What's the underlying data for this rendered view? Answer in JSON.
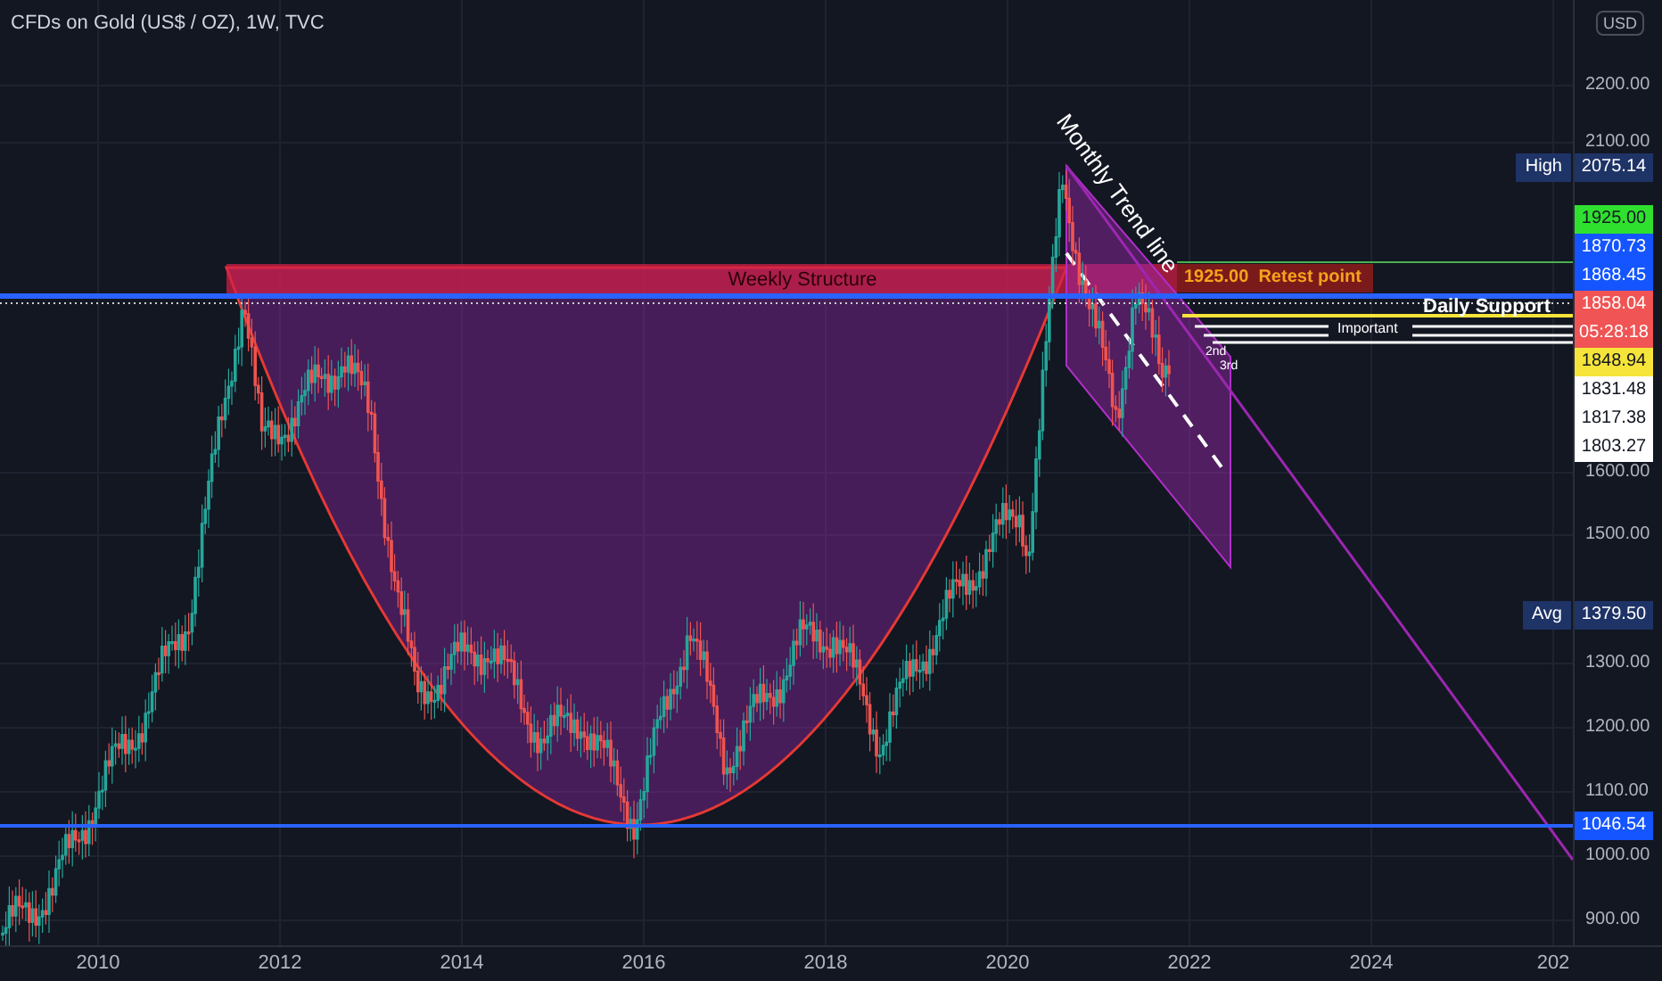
{
  "header": {
    "title": "CFDs on Gold (US$ / OZ), 1W, TVC"
  },
  "price_axis": {
    "currency_button": "USD",
    "ticks": [
      "2200.00",
      "2100.00",
      "1600.00",
      "1500.00",
      "1300.00",
      "1200.00",
      "1100.00",
      "1000.00",
      "900.00"
    ],
    "tags": [
      {
        "label": "High",
        "value": "2075.14",
        "color": "#1e3366"
      },
      {
        "value": "1925.00",
        "color": "#2fe02f"
      },
      {
        "value": "1870.73",
        "color": "#1455ff"
      },
      {
        "value": "1868.45",
        "color": "#1455ff"
      },
      {
        "value": "1858.04",
        "countdown": "05:28:18",
        "color": "#f05454"
      },
      {
        "value": "1848.94",
        "color": "#f7e43a"
      },
      {
        "value": "1831.48",
        "color": "#ffffff"
      },
      {
        "value": "1817.38",
        "color": "#ffffff"
      },
      {
        "value": "1803.27",
        "color": "#ffffff"
      },
      {
        "label": "Avg",
        "value": "1379.50",
        "color": "#1e3366"
      },
      {
        "value": "1046.54",
        "color": "#1455ff"
      }
    ]
  },
  "time_axis": {
    "labels": [
      "2010",
      "2012",
      "2014",
      "2016",
      "2018",
      "2020",
      "2022",
      "2024",
      "202"
    ]
  },
  "drawings": {
    "weekly_structure": "Weekly Structure",
    "retest_point": "1925.00  Retest point",
    "trend_line": "Monthly Trend line",
    "daily_support": "Daily Support",
    "important": "Important",
    "second": "2nd",
    "third": "3rd"
  }
}
